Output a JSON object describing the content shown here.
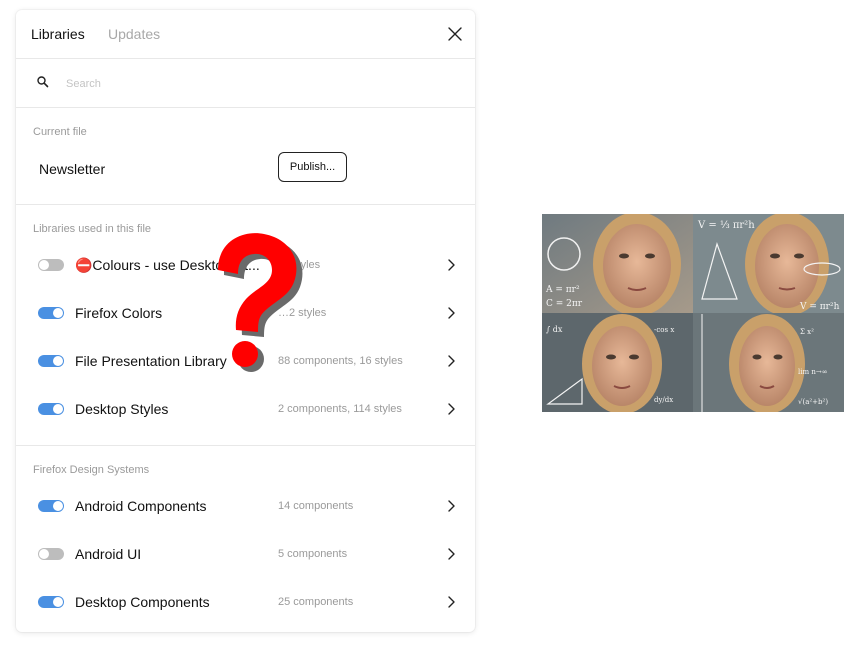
{
  "tabs": [
    {
      "label": "Libraries",
      "active": true
    },
    {
      "label": "Updates",
      "active": false
    }
  ],
  "close_icon": "close-icon",
  "search": {
    "placeholder": "Search",
    "value": "",
    "icon": "search-icon"
  },
  "current_file": {
    "section_label": "Current file",
    "name": "Newsletter",
    "publish_label": "Publish..."
  },
  "libraries_used": {
    "section_label": "Libraries used in this file",
    "items": [
      {
        "name": "⛔Colours - use Desktop St...",
        "meta": "… styles",
        "enabled": false
      },
      {
        "name": "Firefox Colors",
        "meta": "…2 styles",
        "enabled": true
      },
      {
        "name": "File Presentation Library",
        "meta": "88 components, 16 styles",
        "enabled": true
      },
      {
        "name": "Desktop Styles",
        "meta": "2 components, 114 styles",
        "enabled": true
      }
    ]
  },
  "design_systems": {
    "section_label": "Firefox Design Systems",
    "items": [
      {
        "name": "Android Components",
        "meta": "14 components",
        "enabled": true
      },
      {
        "name": "Android UI",
        "meta": "5 components",
        "enabled": false
      },
      {
        "name": "Desktop Components",
        "meta": "25 components",
        "enabled": true
      }
    ]
  },
  "overlay": {
    "symbol": "?",
    "color": "#ff0000"
  },
  "meme_image": {
    "description_icon": "confused-math-lady-meme"
  },
  "colors": {
    "accent": "#4a90e2",
    "toggle_off": "#bdbdbd",
    "muted_text": "#9a9a9a"
  }
}
